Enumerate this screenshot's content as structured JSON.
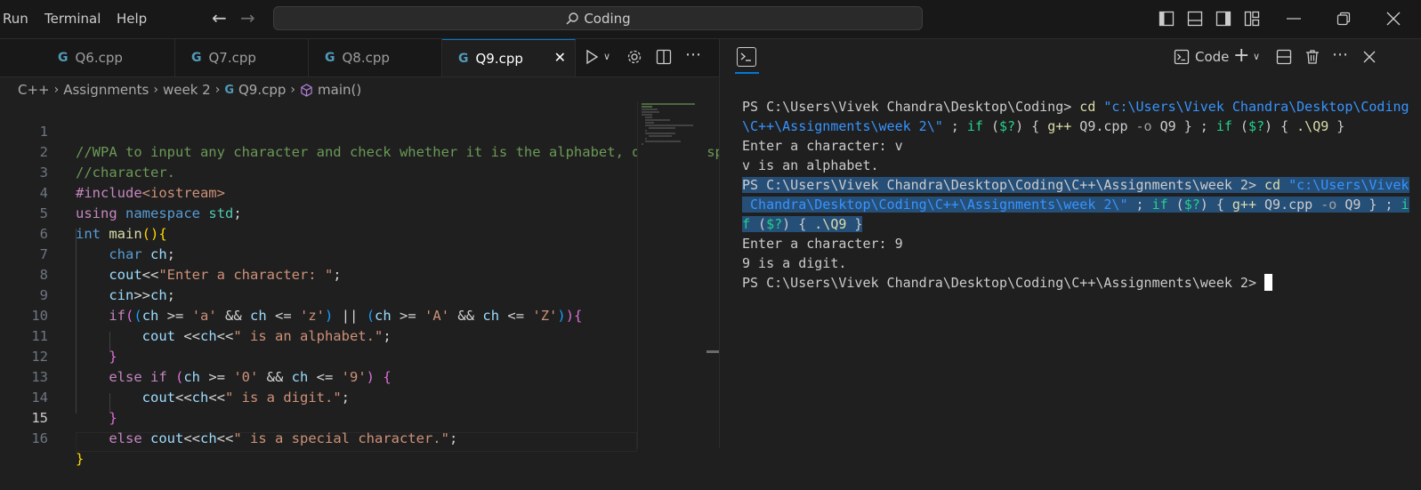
{
  "menu": {
    "run": "Run",
    "terminal": "Terminal",
    "help": "Help"
  },
  "search": {
    "text": "Coding"
  },
  "tabs": [
    {
      "label": "Q6.cpp",
      "icon": "cpp-file-icon"
    },
    {
      "label": "Q7.cpp",
      "icon": "cpp-file-icon"
    },
    {
      "label": "Q8.cpp",
      "icon": "cpp-file-icon"
    },
    {
      "label": "Q9.cpp",
      "icon": "cpp-file-icon",
      "active": true
    }
  ],
  "breadcrumb": [
    "C++",
    "Assignments",
    "week 2",
    "Q9.cpp",
    "main()"
  ],
  "code": {
    "line_numbers": [
      "1",
      "2",
      "3",
      "4",
      "5",
      "6",
      "7",
      "8",
      "9",
      "10",
      "11",
      "12",
      "13",
      "14",
      "15",
      "16"
    ],
    "current_line": "15",
    "l1": "//WPA to input any character and check whether it is the alphabet, digit or special",
    "l2": "//character.",
    "l3a": "#include",
    "l3b": "<iostream>",
    "l4a": "using",
    "l4b": "namespace",
    "l4c": "std",
    "l4d": ";",
    "l5a": "int",
    "l5b": "main",
    "l5c": "()",
    "l5d": "{",
    "l6a": "char",
    "l6b": "ch",
    "l6c": ";",
    "l7a": "cout",
    "l7b": "<<",
    "l7c": "\"Enter a character: \"",
    "l7d": ";",
    "l8a": "cin",
    "l8b": ">>",
    "l8c": "ch",
    "l8d": ";",
    "l9": {
      "if": "if",
      "p1": "(",
      "p2": "(",
      "ch1": "ch",
      "op1": " >= ",
      "s1": "'a'",
      "and1": " && ",
      "ch2": "ch",
      "op2": " <= ",
      "s2": "'z'",
      "p3": ")",
      "or": " || ",
      "p4": "(",
      "ch3": "ch",
      "op3": " >= ",
      "s3": "'A'",
      "and2": " && ",
      "ch4": "ch",
      "op4": " <= ",
      "s4": "'Z'",
      "p5": ")",
      "p6": ")",
      "br": "{"
    },
    "l10a": "cout",
    "l10b": " <<",
    "l10c": "ch",
    "l10d": "<<",
    "l10e": "\" is an alphabet.\"",
    "l10f": ";",
    "l11": "}",
    "l12": {
      "else": "else",
      "if": " if",
      "p1": " (",
      "ch1": "ch",
      "op1": " >= ",
      "s1": "'0'",
      "and": " && ",
      "ch2": "ch",
      "op2": " <= ",
      "s2": "'9'",
      "p2": ")",
      "br": " {"
    },
    "l13a": "cout",
    "l13b": "<<",
    "l13c": "ch",
    "l13d": "<<",
    "l13e": "\" is a digit.\"",
    "l13f": ";",
    "l14": "}",
    "l15a": "else",
    "l15b": " cout",
    "l15c": "<<",
    "l15d": "ch",
    "l15e": "<<",
    "l15f": "\" is a special character.\"",
    "l15g": ";",
    "l16": "}"
  },
  "terminal_header": {
    "profile": "Code"
  },
  "terminal": {
    "t1a": "PS C:\\Users\\Vivek Chandra\\Desktop\\Coding> ",
    "t1b": "cd",
    "t1c": " \"c:\\Users\\Vivek Chandra\\Desktop\\Coding",
    "t2a": "\\C++\\Assignments\\week 2\\\"",
    "t2b": " ; ",
    "t2c": "if",
    "t2d": " (",
    "t2e": "$?",
    "t2f": ") { ",
    "t2g": "g++",
    "t2h": " Q9.cpp ",
    "t2i": "-o",
    "t2j": " Q9 } ; ",
    "t2k": "if",
    "t2l": " (",
    "t2m": "$?",
    "t2n": ") { ",
    "t2o": ".\\Q9",
    "t2p": " }",
    "t3": "Enter a character: v",
    "t4": "v is an alphabet.",
    "t5a": "PS C:\\Users\\Vivek Chandra\\Desktop\\Coding\\C++\\Assignments\\week 2> ",
    "t5b": "cd",
    "t5c": " \"c:\\Users\\Vivek",
    "t6a": " Chandra\\Desktop\\Coding\\C++\\Assignments\\week 2\\\"",
    "t6b": " ; ",
    "t6c": "if",
    "t6d": " (",
    "t6e": "$?",
    "t6f": ") { ",
    "t6g": "g++",
    "t6h": " Q9.cpp ",
    "t6i": "-o",
    "t6j": " Q9 } ; ",
    "t6k": "i",
    "t7a": "f",
    "t7b": " (",
    "t7c": "$?",
    "t7d": ") { ",
    "t7e": ".\\Q9",
    "t7f": " }",
    "t8": "Enter a character: 9",
    "t9": "9 is a digit.",
    "t10": "PS C:\\Users\\Vivek Chandra\\Desktop\\Coding\\C++\\Assignments\\week 2> "
  }
}
